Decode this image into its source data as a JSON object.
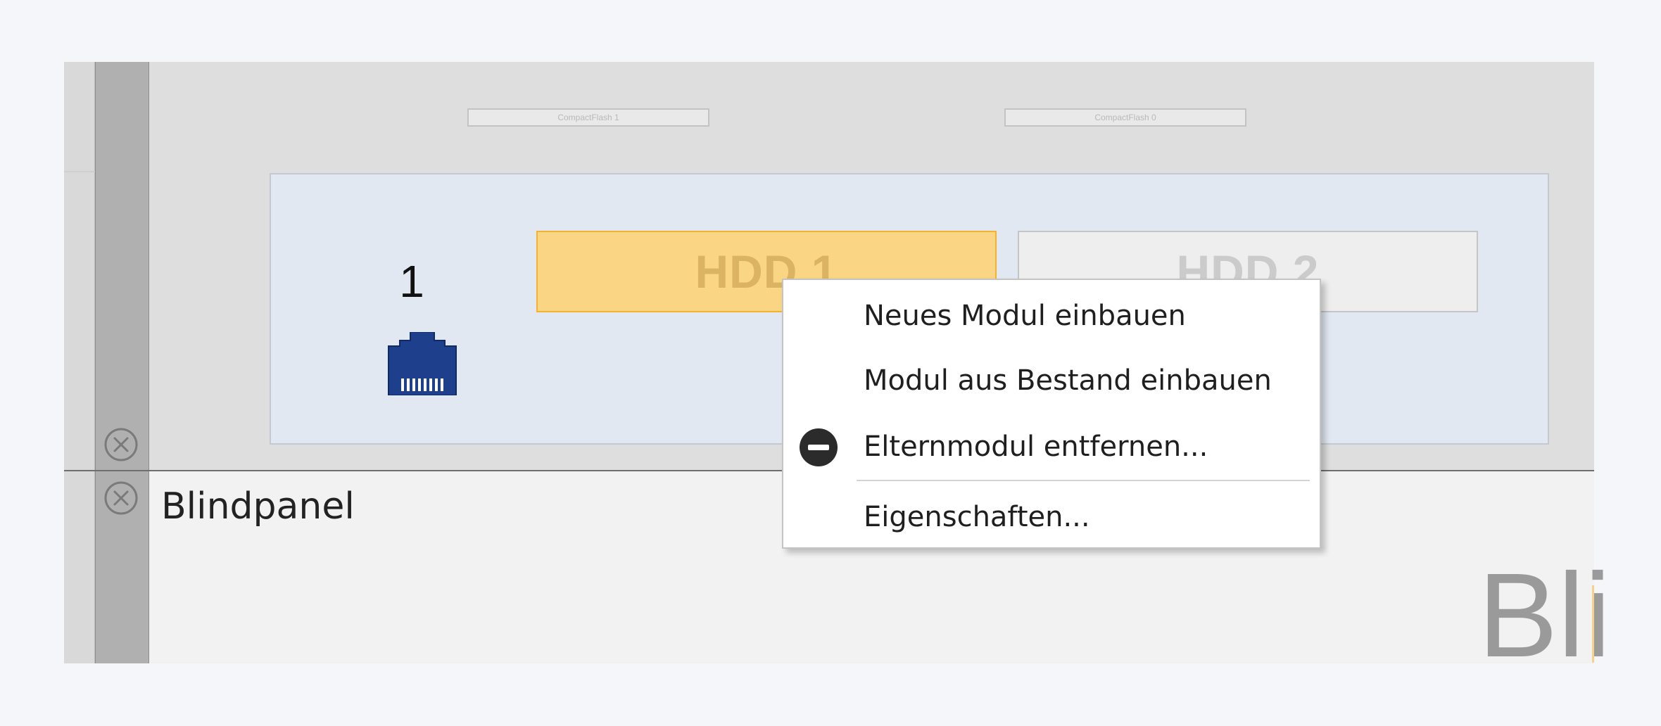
{
  "rack": {
    "cf_slots": [
      "CompactFlash 1",
      "CompactFlash 0"
    ],
    "port_number": "1",
    "drives": [
      "HDD 1",
      "HDD 2"
    ],
    "blind_panel": {
      "label": "Blindpanel",
      "watermark": "Bli"
    }
  },
  "context_menu": {
    "items": [
      {
        "label": "Neues Modul einbauen",
        "icon": null
      },
      {
        "label": "Modul aus Bestand einbauen",
        "icon": null
      },
      {
        "label": "Elternmodul entfernen...",
        "icon": "minus-circle-icon"
      },
      {
        "label": "Eigenschaften...",
        "icon": null
      }
    ]
  },
  "colors": {
    "highlight_fill": "#fad584",
    "highlight_border": "#f5b22e",
    "port_icon": "#1d3f8c",
    "remove_icon": "#2b2b2b"
  }
}
